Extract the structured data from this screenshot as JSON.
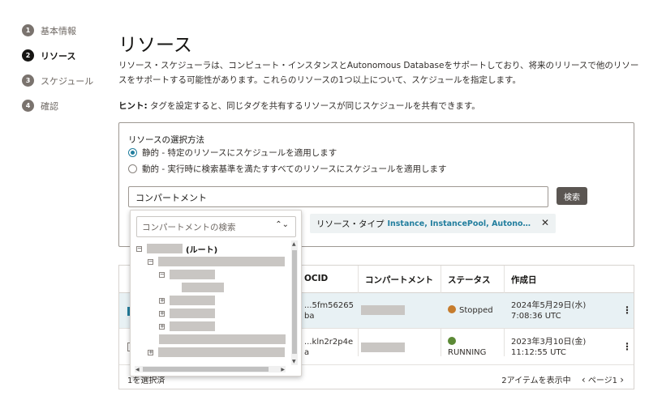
{
  "steps": [
    {
      "num": "1",
      "label": "基本情報"
    },
    {
      "num": "2",
      "label": "リソース"
    },
    {
      "num": "3",
      "label": "スケジュール"
    },
    {
      "num": "4",
      "label": "確認"
    }
  ],
  "page": {
    "title": "リソース",
    "description": "リソース・スケジューラは、コンピュート・インスタンスとAutonomous Databaseをサポートしており、将来のリリースで他のリソースをサポートする可能性があります。これらのリソースの1つ以上について、スケジュールを指定します。",
    "hint_label": "ヒント:",
    "hint_text": " タグを設定すると、同じタグを共有するリソースが同じスケジュールを共有できます。"
  },
  "selection": {
    "legend": "リソースの選択方法",
    "static_option": "静的 - 特定のリソースにスケジュールを適用します",
    "dynamic_option": "動的 - 実行時に検索基準を満たすすべてのリソースにスケジュールを適用します",
    "compartment_input_value": "コンパートメント",
    "search_button": "検索",
    "chip_label": "リソース・タイプ",
    "chip_value": "Instance, InstancePool, Autonom...",
    "chip_close": "✕"
  },
  "dropdown": {
    "search_placeholder": "コンパートメントの検索",
    "chevron": "⌃⌄",
    "root_label": "(ルート)"
  },
  "table": {
    "headers": [
      "OCID",
      "コンパートメント",
      "ステータス",
      "作成日"
    ],
    "rows": [
      {
        "ocid_line1": "...5fm56265",
        "ocid_line2": "ba",
        "status": "Stopped",
        "status_color": "#c67c2d",
        "date_line1": "2024年5月29日(水)",
        "date_line2": "7:08:36 UTC",
        "checked": true
      },
      {
        "ocid_line1": "...kln2r2p4e",
        "ocid_line2": "a",
        "status": "RUNNING",
        "status_color": "#5c8a36",
        "date_line1": "2023年3月10日(金)",
        "date_line2": "11:12:55 UTC",
        "checked": false
      }
    ],
    "footer_left": "1を選択済",
    "footer_right": "2アイテムを表示中",
    "pager": "ページ1",
    "kebab": "⋮"
  },
  "colors": {
    "accent": "#227e9e",
    "stopped": "#c67c2d",
    "running": "#5c8a36"
  }
}
